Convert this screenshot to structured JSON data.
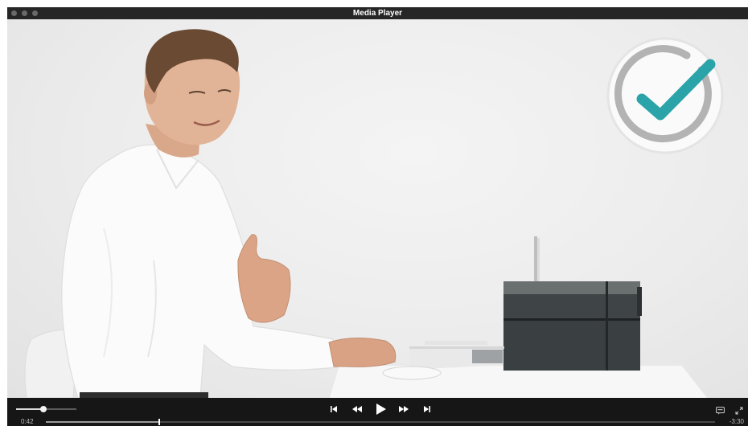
{
  "window": {
    "title": "Media Player"
  },
  "player": {
    "current_time": "0:42",
    "remaining_time": "-3:30",
    "volume": 0.45,
    "progress": 0.17,
    "state": "paused"
  },
  "controls": {
    "volume_icon": "volume-slider",
    "skip_back_icon": "skip-previous-icon",
    "rewind_icon": "rewind-icon",
    "play_icon": "play-icon",
    "forward_icon": "fast-forward-icon",
    "skip_forward_icon": "skip-next-icon",
    "subtitles_icon": "subtitles-icon",
    "fullscreen_icon": "fullscreen-icon"
  },
  "colors": {
    "accent": "#2aa3a9",
    "bar": "#161616"
  }
}
